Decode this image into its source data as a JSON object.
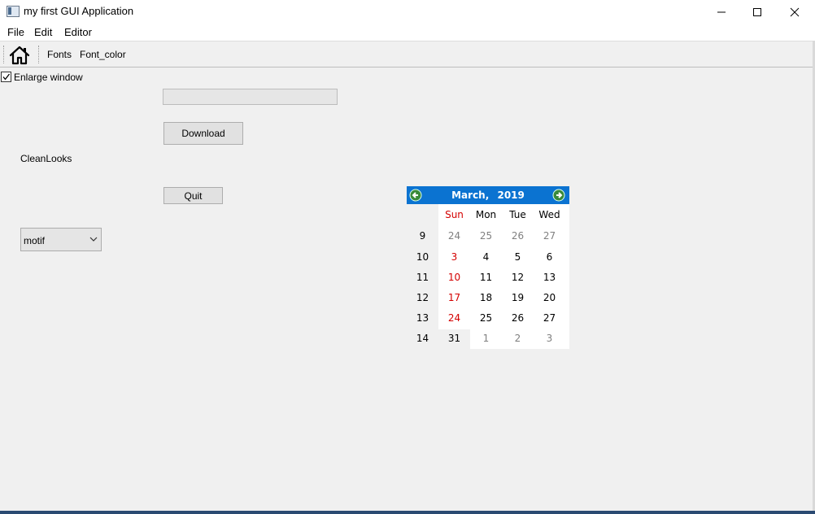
{
  "window": {
    "title": "my first GUI Application"
  },
  "menu": {
    "items": [
      "File",
      "Edit",
      "Editor"
    ]
  },
  "toolbar": {
    "home_icon": "home-icon",
    "fonts_label": "Fonts",
    "font_color_label": "Font_color"
  },
  "checkbox": {
    "label": "Enlarge window",
    "checked": true
  },
  "progress": {
    "value": 0
  },
  "buttons": {
    "download": "Download",
    "quit": "Quit"
  },
  "static_label": "CleanLooks",
  "style_combo": {
    "value": "motif"
  },
  "calendar": {
    "month": "March,",
    "year": "2019",
    "header_color": "#0b73d1",
    "weekend_color": "#d40000",
    "day_headers": [
      "Sun",
      "Mon",
      "Tue",
      "Wed"
    ],
    "weeks": [
      {
        "week": "9",
        "days": [
          "24",
          "25",
          "26",
          "27"
        ]
      },
      {
        "week": "10",
        "days": [
          "3",
          "4",
          "5",
          "6"
        ]
      },
      {
        "week": "11",
        "days": [
          "10",
          "11",
          "12",
          "13"
        ]
      },
      {
        "week": "12",
        "days": [
          "17",
          "18",
          "19",
          "20"
        ]
      },
      {
        "week": "13",
        "days": [
          "24",
          "25",
          "26",
          "27"
        ]
      },
      {
        "week": "14",
        "days": [
          "31",
          "1",
          "2",
          "3"
        ]
      }
    ],
    "selected_date": "31"
  }
}
